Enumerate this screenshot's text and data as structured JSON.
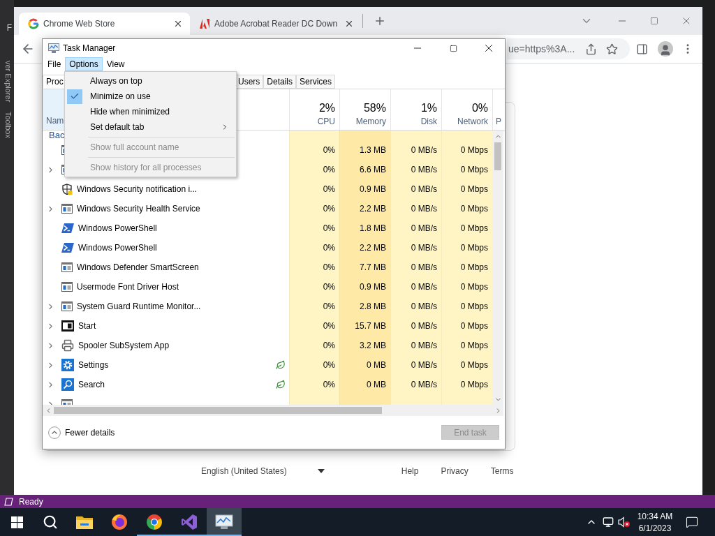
{
  "ide": {
    "menu_letter": "F",
    "side_tabs": [
      "ver Explorer",
      "Toolbox"
    ],
    "status": "Ready"
  },
  "browser": {
    "tabs": [
      {
        "title": "Chrome Web Store",
        "kind": "google",
        "selected": true
      },
      {
        "title": "Adobe Acrobat Reader DC Down",
        "kind": "adobe",
        "selected": false
      }
    ],
    "address": "ue=https%3A...",
    "footer": {
      "language": "English (United States)",
      "links": [
        "Help",
        "Privacy",
        "Terms"
      ]
    }
  },
  "task_manager": {
    "title": "Task Manager",
    "menu": [
      {
        "label": "File",
        "selected": false
      },
      {
        "label": "Options",
        "selected": true
      },
      {
        "label": "View",
        "selected": false
      }
    ],
    "options_menu": [
      {
        "kind": "item",
        "label": "Always on top",
        "checked": false,
        "disabled": false
      },
      {
        "kind": "item",
        "label": "Minimize on use",
        "checked": true,
        "disabled": false
      },
      {
        "kind": "item",
        "label": "Hide when minimized",
        "checked": false,
        "disabled": false
      },
      {
        "kind": "submenu",
        "label": "Set default tab",
        "checked": false,
        "disabled": false
      },
      {
        "kind": "separator"
      },
      {
        "kind": "item",
        "label": "Show full account name",
        "checked": false,
        "disabled": true
      },
      {
        "kind": "separator"
      },
      {
        "kind": "item",
        "label": "Show history for all processes",
        "checked": false,
        "disabled": true
      }
    ],
    "tabs": [
      {
        "label": "Proc",
        "selected": true
      },
      {
        "label": "Users",
        "selected": false
      },
      {
        "label": "Details",
        "selected": false
      },
      {
        "label": "Services",
        "selected": false
      }
    ],
    "name_header": "Nam",
    "metrics": [
      {
        "percent": "2%",
        "label": "CPU"
      },
      {
        "percent": "58%",
        "label": "Memory"
      },
      {
        "percent": "1%",
        "label": "Disk"
      },
      {
        "percent": "0%",
        "label": "Network"
      }
    ],
    "cut_header": "P",
    "group": "Bac",
    "rows": [
      {
        "kind": "generic",
        "expandable": false,
        "efficiency": false,
        "cpu": "0%",
        "memory": "1.3 MB",
        "disk": "0 MB/s",
        "network": "0 Mbps"
      },
      {
        "kind": "generic",
        "expandable": true,
        "efficiency": false,
        "cpu": "0%",
        "memory": "6.6 MB",
        "disk": "0 MB/s",
        "network": "0 Mbps"
      },
      {
        "name": "Windows Security notification i...",
        "kind": "shield",
        "expandable": false,
        "efficiency": false,
        "cpu": "0%",
        "memory": "0.9 MB",
        "disk": "0 MB/s",
        "network": "0 Mbps"
      },
      {
        "name": "Windows Security Health Service",
        "kind": "generic",
        "expandable": true,
        "efficiency": false,
        "cpu": "0%",
        "memory": "2.2 MB",
        "disk": "0 MB/s",
        "network": "0 Mbps"
      },
      {
        "name": "Windows PowerShell",
        "kind": "powershell",
        "expandable": false,
        "efficiency": false,
        "cpu": "0%",
        "memory": "1.8 MB",
        "disk": "0 MB/s",
        "network": "0 Mbps"
      },
      {
        "name": "Windows PowerShell",
        "kind": "powershell",
        "expandable": false,
        "efficiency": false,
        "cpu": "0%",
        "memory": "2.2 MB",
        "disk": "0 MB/s",
        "network": "0 Mbps"
      },
      {
        "name": "Windows Defender SmartScreen",
        "kind": "generic",
        "expandable": false,
        "efficiency": false,
        "cpu": "0%",
        "memory": "7.7 MB",
        "disk": "0 MB/s",
        "network": "0 Mbps"
      },
      {
        "name": "Usermode Font Driver Host",
        "kind": "generic",
        "expandable": false,
        "efficiency": false,
        "cpu": "0%",
        "memory": "0.9 MB",
        "disk": "0 MB/s",
        "network": "0 Mbps"
      },
      {
        "name": "System Guard Runtime Monitor...",
        "kind": "generic",
        "expandable": true,
        "efficiency": false,
        "cpu": "0%",
        "memory": "2.8 MB",
        "disk": "0 MB/s",
        "network": "0 Mbps"
      },
      {
        "name": "Start",
        "kind": "start",
        "expandable": true,
        "efficiency": false,
        "cpu": "0%",
        "memory": "15.7 MB",
        "disk": "0 MB/s",
        "network": "0 Mbps"
      },
      {
        "name": "Spooler SubSystem App",
        "kind": "printer",
        "expandable": true,
        "efficiency": false,
        "cpu": "0%",
        "memory": "3.2 MB",
        "disk": "0 MB/s",
        "network": "0 Mbps"
      },
      {
        "name": "Settings",
        "kind": "settings",
        "expandable": true,
        "efficiency": true,
        "cpu": "0%",
        "memory": "0 MB",
        "disk": "0 MB/s",
        "network": "0 Mbps"
      },
      {
        "name": "Search",
        "kind": "search",
        "expandable": true,
        "efficiency": true,
        "cpu": "0%",
        "memory": "0 MB",
        "disk": "0 MB/s",
        "network": "0 Mbps"
      },
      {
        "kind": "generic",
        "expandable": true,
        "efficiency": false
      }
    ],
    "footer": {
      "toggle": "Fewer details",
      "end_task": "End task",
      "end_task_disabled": true
    }
  },
  "taskbar": {
    "apps": [
      {
        "kind": "start",
        "running": false,
        "selected": false
      },
      {
        "kind": "search",
        "running": false,
        "selected": false
      },
      {
        "kind": "explorer",
        "running": false,
        "selected": false
      },
      {
        "kind": "firefox",
        "running": false,
        "selected": false
      },
      {
        "kind": "chrome",
        "running": true,
        "selected": false
      },
      {
        "kind": "studio",
        "running": true,
        "selected": false
      },
      {
        "kind": "taskmanager",
        "running": true,
        "selected": true
      }
    ],
    "time": "10:34 AM",
    "date": "6/1/2023"
  }
}
